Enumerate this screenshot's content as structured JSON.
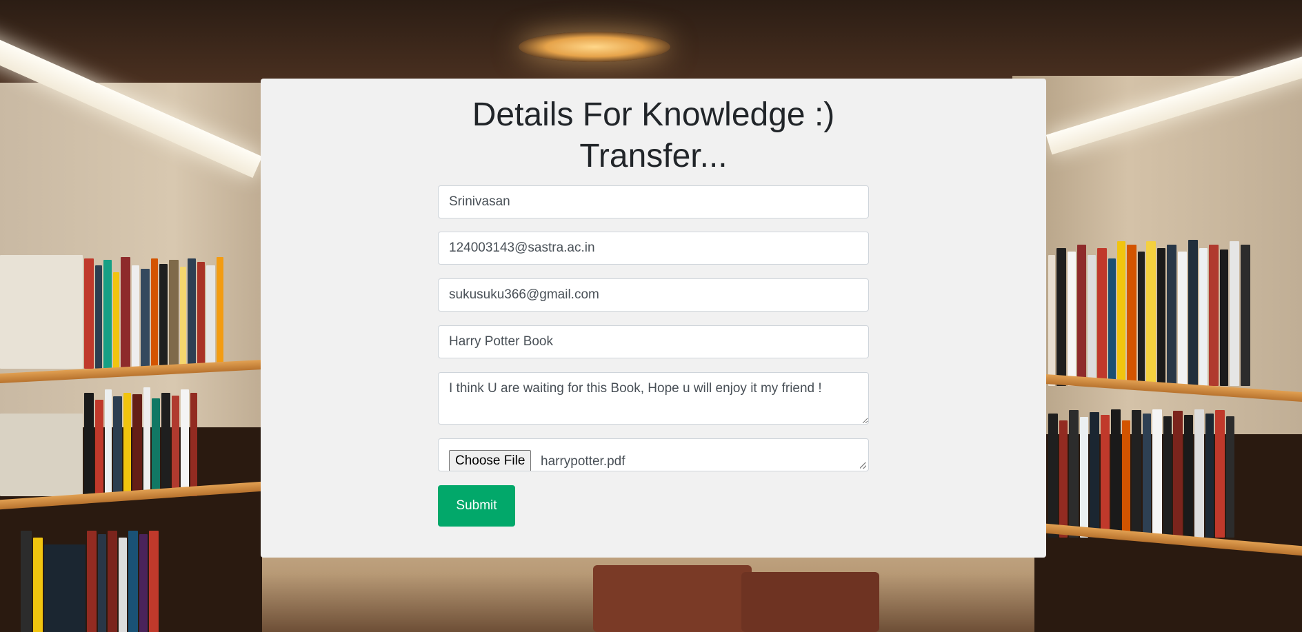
{
  "form": {
    "title_line1": "Details For Knowledge :)",
    "title_line2": "Transfer...",
    "name_value": "Srinivasan",
    "from_email_value": "124003143@sastra.ac.in",
    "to_email_value": "sukusuku366@gmail.com",
    "subject_value": "Harry Potter Book",
    "message_value": "I think U are waiting for this Book, Hope u will enjoy it my friend !",
    "file_button_label": "Choose File",
    "file_name": "harrypotter.pdf",
    "submit_label": "Submit"
  },
  "colors": {
    "card_background": "#f1f1f1",
    "submit_background": "#02a86a",
    "title_text": "#212529"
  }
}
